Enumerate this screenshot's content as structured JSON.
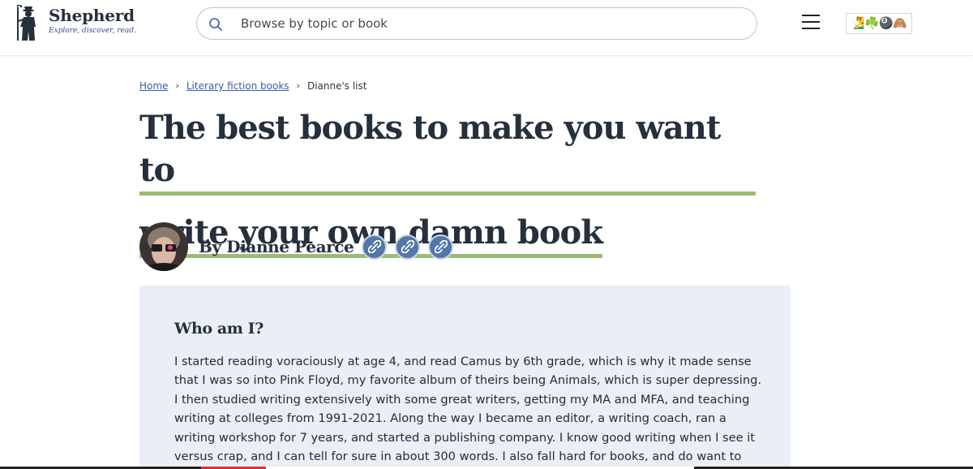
{
  "header": {
    "logo_name": "Shepherd",
    "logo_tagline": "Explore, discover, read.",
    "search_placeholder": "Browse by topic or book",
    "emoji_strip": "🧏‍♂️☘️🎱🙈"
  },
  "breadcrumb": {
    "items": [
      "Home",
      "Literary fiction books",
      "Dianne's list"
    ],
    "separator": "›"
  },
  "page": {
    "title_line1": "The best books to make you want to",
    "title_line2": "write your own damn book",
    "author": "By Dianne Pearce",
    "social_icons": [
      "link-icon",
      "link-icon",
      "link-icon"
    ]
  },
  "about": {
    "heading": "Who am I?",
    "body": "I started reading voraciously at age 4, and read Camus by 6th grade, which is why it made sense that I was so into Pink Floyd, my favorite album of theirs being Animals, which is super depressing. I then studied writing extensively with some great writers, getting my MA and MFA, and teaching writing at colleges from 1991-2021. Along the way I became an editor, a writing coach, ran a writing workshop for 7 years, and started a publishing company. I know good writing when I see it versus crap, and I can tell for sure in about 300 words. I also fall hard for books, and do want to marry them."
  },
  "colors": {
    "title_underline": "#9cbb77",
    "social_button": "#5277a8",
    "card_background": "#e9eef7",
    "link": "#3b5ba9"
  }
}
